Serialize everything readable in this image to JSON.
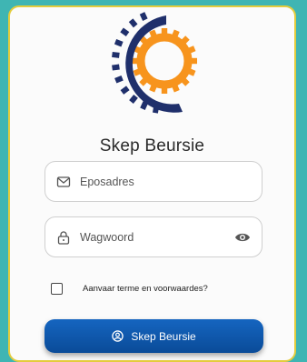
{
  "form": {
    "title": "Skep Beursie",
    "email_placeholder": "Eposadres",
    "email_value": "",
    "password_placeholder": "Wagwoord",
    "password_value": "",
    "terms_label": "Aanvaar terme en voorwaardes?",
    "terms_checked": false,
    "submit_label": "Skep Beursie"
  },
  "icons": {
    "logo": "gear-logo-icon",
    "email": "envelope-icon",
    "password": "lock-icon",
    "toggle_password": "eye-icon",
    "submit": "user-circle-icon"
  },
  "colors": {
    "background": "#3fb5b3",
    "card_border": "#e4cc3c",
    "logo_orange": "#f7941d",
    "logo_navy": "#1f2f6b",
    "button": "#1565c0"
  }
}
